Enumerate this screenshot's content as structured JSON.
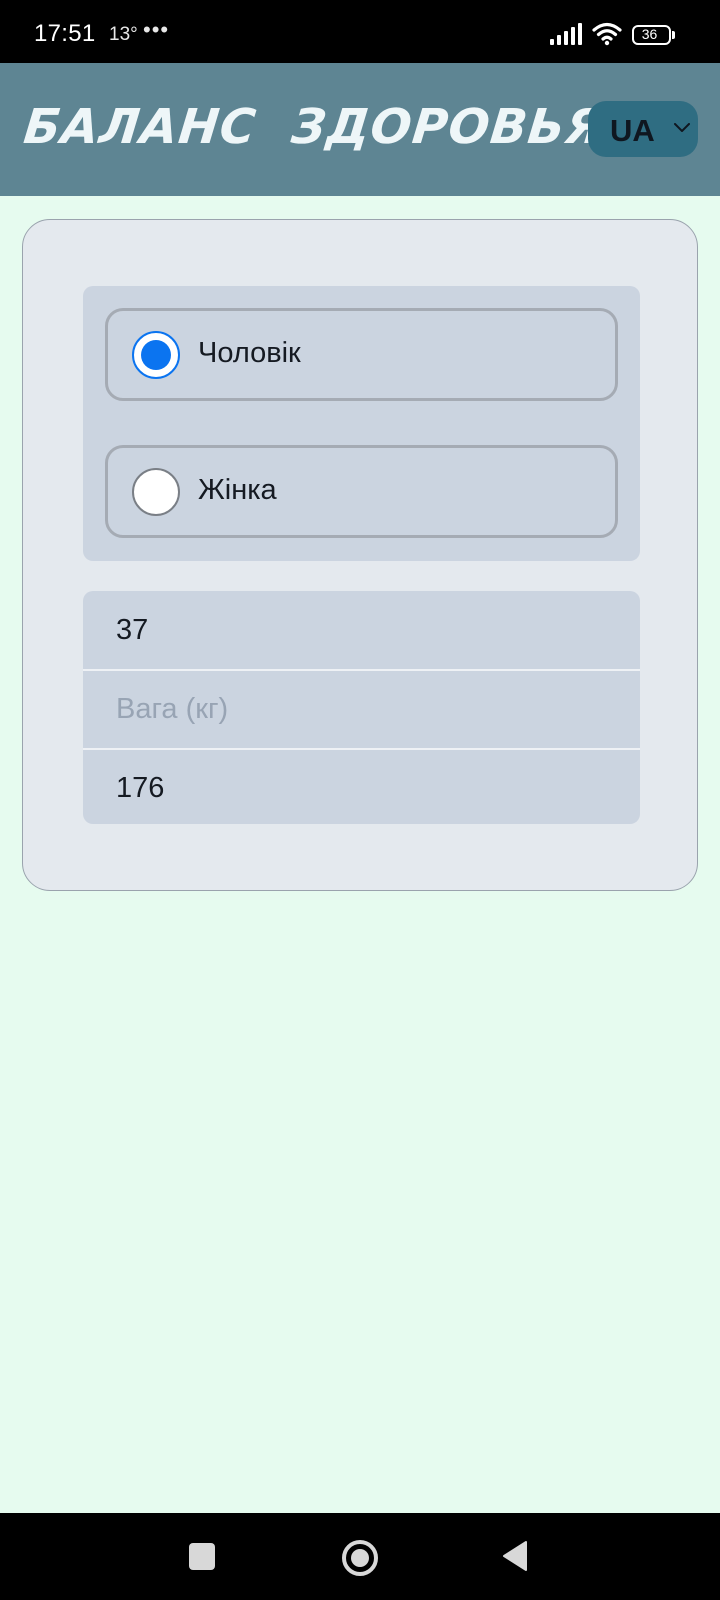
{
  "status_bar": {
    "time": "17:51",
    "temperature": "13°",
    "more": "•••",
    "battery_level": "36",
    "icons": [
      "signal-icon",
      "wifi-icon",
      "battery-icon"
    ]
  },
  "header": {
    "title": "БАЛАНС ЗДОРОВЬЯ",
    "language": "UA",
    "background_color": "#5e8593",
    "language_button_color": "#2f6d82"
  },
  "form": {
    "gender_options": [
      {
        "label": "Чоловік",
        "selected": true
      },
      {
        "label": "Жінка",
        "selected": false
      }
    ],
    "fields": [
      {
        "value": "37",
        "placeholder": ""
      },
      {
        "value": "",
        "placeholder": "Вага (кг)"
      },
      {
        "value": "176",
        "placeholder": ""
      }
    ],
    "accent_color": "#0b74f0"
  },
  "nav_bar": {
    "icons": [
      "recent-apps-icon",
      "home-icon",
      "back-icon"
    ]
  }
}
